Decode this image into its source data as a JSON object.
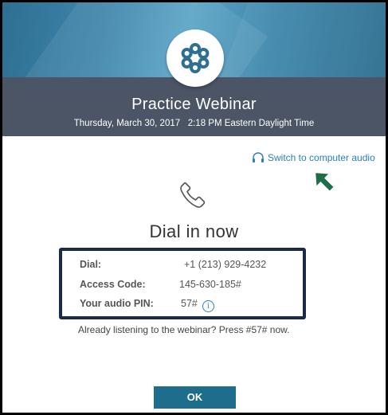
{
  "header": {
    "title": "Practice Webinar",
    "datetime": "Thursday, March 30, 2017   2:18 PM Eastern Daylight Time"
  },
  "audio": {
    "switch_label": "Switch to computer audio",
    "heading": "Dial in now",
    "dial": {
      "label": "Dial:",
      "value": "+1 (213) 929-4232"
    },
    "access_code": {
      "label": "Access Code:",
      "value": "145-630-185#"
    },
    "audio_pin": {
      "label": "Your audio PIN:",
      "value": "57#"
    },
    "info_glyph": "i",
    "listening_text": "Already listening to the webinar? Press #57# now."
  },
  "footer": {
    "ok_label": "OK"
  },
  "colors": {
    "accent_blue": "#2c7fbf",
    "header_dark": "#4b5566",
    "button": "#1f6d8d",
    "annotation_arrow": "#1f6e4a",
    "annotation_box": "#1a2b4a"
  }
}
